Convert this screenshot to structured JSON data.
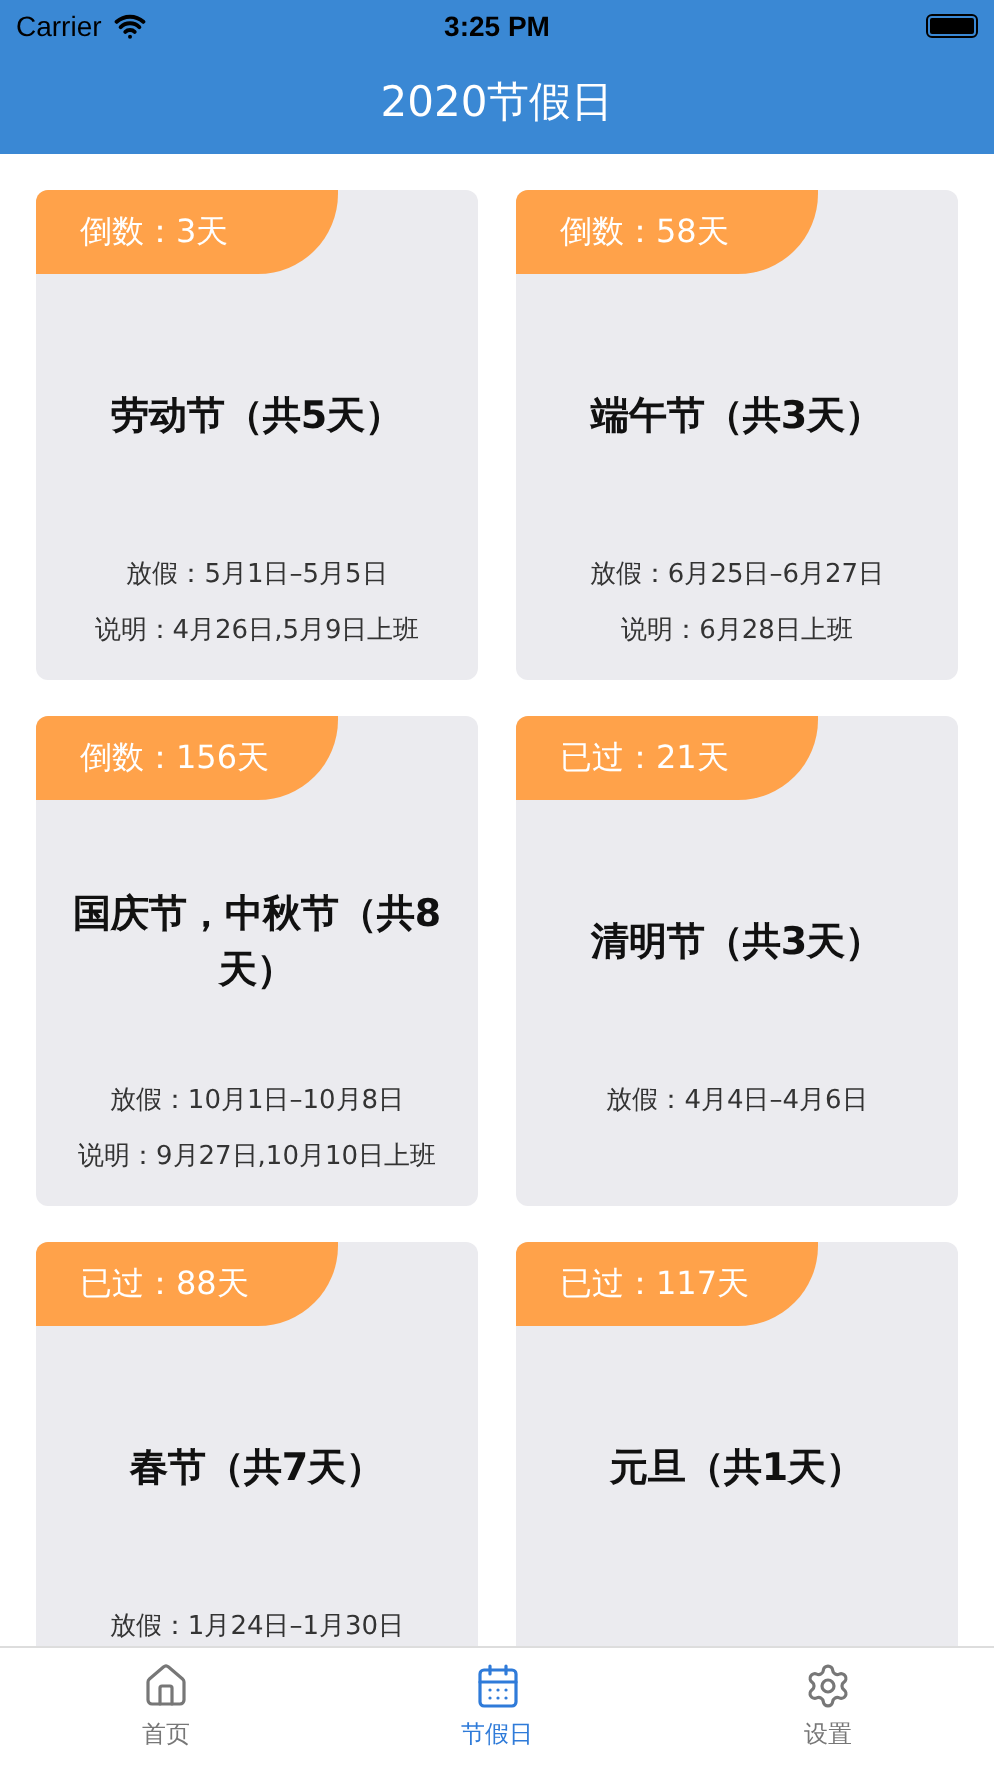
{
  "status_bar": {
    "carrier": "Carrier",
    "time": "3:25 PM"
  },
  "nav_bar": {
    "title": "2020节假日"
  },
  "holidays": [
    {
      "badge": "倒数：3天",
      "title": "劳动节（共5天）",
      "dates": "放假：5月1日–5月5日",
      "note": "说明：4月26日,5月9日上班"
    },
    {
      "badge": "倒数：58天",
      "title": "端午节（共3天）",
      "dates": "放假：6月25日–6月27日",
      "note": "说明：6月28日上班"
    },
    {
      "badge": "倒数：156天",
      "title": "国庆节，中秋节（共8天）",
      "dates": "放假：10月1日–10月8日",
      "note": "说明：9月27日,10月10日上班"
    },
    {
      "badge": "已过：21天",
      "title": "清明节（共3天）",
      "dates": "放假：4月4日–4月6日"
    },
    {
      "badge": "已过：88天",
      "title": "春节（共7天）",
      "dates": "放假：1月24日–1月30日"
    },
    {
      "badge": "已过：117天",
      "title": "元旦（共1天）"
    }
  ],
  "tab_bar": [
    {
      "kind": "home",
      "label": "首页",
      "selected": false
    },
    {
      "kind": "calendar",
      "label": "节假日",
      "selected": true
    },
    {
      "kind": "settings",
      "label": "设置",
      "selected": false
    }
  ]
}
